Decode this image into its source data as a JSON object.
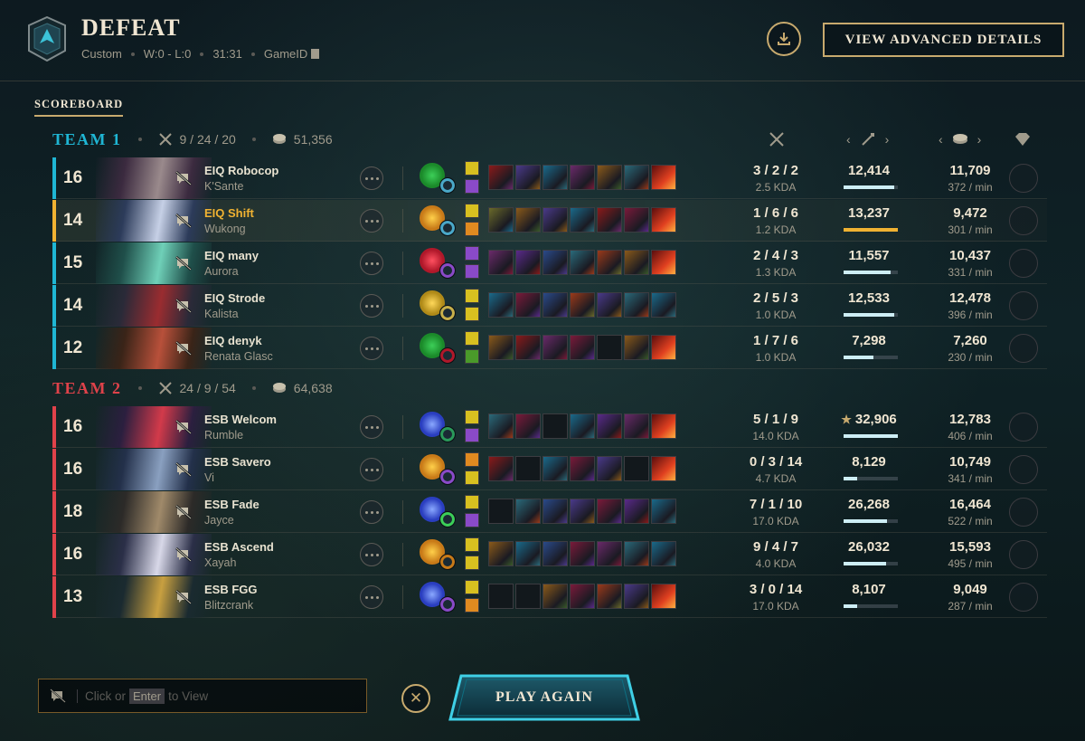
{
  "header": {
    "title": "DEFEAT",
    "mode": "Custom",
    "record": "W:0 - L:0",
    "duration": "31:31",
    "game_id_label": "GameID",
    "advanced_label": "VIEW ADVANCED DETAILS"
  },
  "tabs": {
    "scoreboard": "SCOREBOARD"
  },
  "colors": {
    "team1": "#1fb6d4",
    "team2": "#e0424a",
    "gold": "#c8aa6e",
    "highlight": "#f0b232"
  },
  "team1": {
    "name": "TEAM 1",
    "kda": "9 / 24 / 20",
    "gold": "51,356",
    "players": [
      {
        "level": "16",
        "name": "EIQ Robocop",
        "champion": "K'Sante",
        "kda": "3 / 2 / 2",
        "kda_ratio": "2.5 KDA",
        "damage": "12,414",
        "damage_frac": 0.93,
        "gold": "11,709",
        "gpm": "372 / min"
      },
      {
        "level": "14",
        "name": "EIQ Shift",
        "champion": "Wukong",
        "kda": "1 / 6 / 6",
        "kda_ratio": "1.2 KDA",
        "damage": "13,237",
        "damage_frac": 1.0,
        "gold": "9,472",
        "gpm": "301 / min"
      },
      {
        "level": "15",
        "name": "EIQ many",
        "champion": "Aurora",
        "kda": "2 / 4 / 3",
        "kda_ratio": "1.3 KDA",
        "damage": "11,557",
        "damage_frac": 0.87,
        "gold": "10,437",
        "gpm": "331 / min"
      },
      {
        "level": "14",
        "name": "EIQ Strode",
        "champion": "Kalista",
        "kda": "2 / 5 / 3",
        "kda_ratio": "1.0 KDA",
        "damage": "12,533",
        "damage_frac": 0.94,
        "gold": "12,478",
        "gpm": "396 / min"
      },
      {
        "level": "12",
        "name": "EIQ denyk",
        "champion": "Renata Glasc",
        "kda": "1 / 7 / 6",
        "kda_ratio": "1.0 KDA",
        "damage": "7,298",
        "damage_frac": 0.55,
        "gold": "7,260",
        "gpm": "230 / min"
      }
    ]
  },
  "team2": {
    "name": "TEAM 2",
    "kda": "24 / 9 / 54",
    "gold": "64,638",
    "players": [
      {
        "level": "16",
        "name": "ESB Welcom",
        "champion": "Rumble",
        "kda": "5 / 1 / 9",
        "kda_ratio": "14.0 KDA",
        "damage": "32,906",
        "damage_star": "★",
        "damage_frac": 1.0,
        "gold": "12,783",
        "gpm": "406 / min"
      },
      {
        "level": "16",
        "name": "ESB Savero",
        "champion": "Vi",
        "kda": "0 / 3 / 14",
        "kda_ratio": "4.7 KDA",
        "damage": "8,129",
        "damage_frac": 0.25,
        "gold": "10,749",
        "gpm": "341 / min"
      },
      {
        "level": "18",
        "name": "ESB Fade",
        "champion": "Jayce",
        "kda": "7 / 1 / 10",
        "kda_ratio": "17.0 KDA",
        "damage": "26,268",
        "damage_frac": 0.8,
        "gold": "16,464",
        "gpm": "522 / min"
      },
      {
        "level": "16",
        "name": "ESB Ascend",
        "champion": "Xayah",
        "kda": "9 / 4 / 7",
        "kda_ratio": "4.0 KDA",
        "damage": "26,032",
        "damage_frac": 0.79,
        "gold": "15,593",
        "gpm": "495 / min"
      },
      {
        "level": "13",
        "name": "ESB FGG",
        "champion": "Blitzcrank",
        "kda": "3 / 0 / 14",
        "kda_ratio": "17.0 KDA",
        "damage": "8,107",
        "damage_frac": 0.25,
        "gold": "9,049",
        "gpm": "287 / min"
      }
    ]
  },
  "footer": {
    "chat_prefix": "Click or",
    "chat_key": "Enter",
    "chat_suffix": "to View",
    "play_again": "PLAY AGAIN"
  }
}
